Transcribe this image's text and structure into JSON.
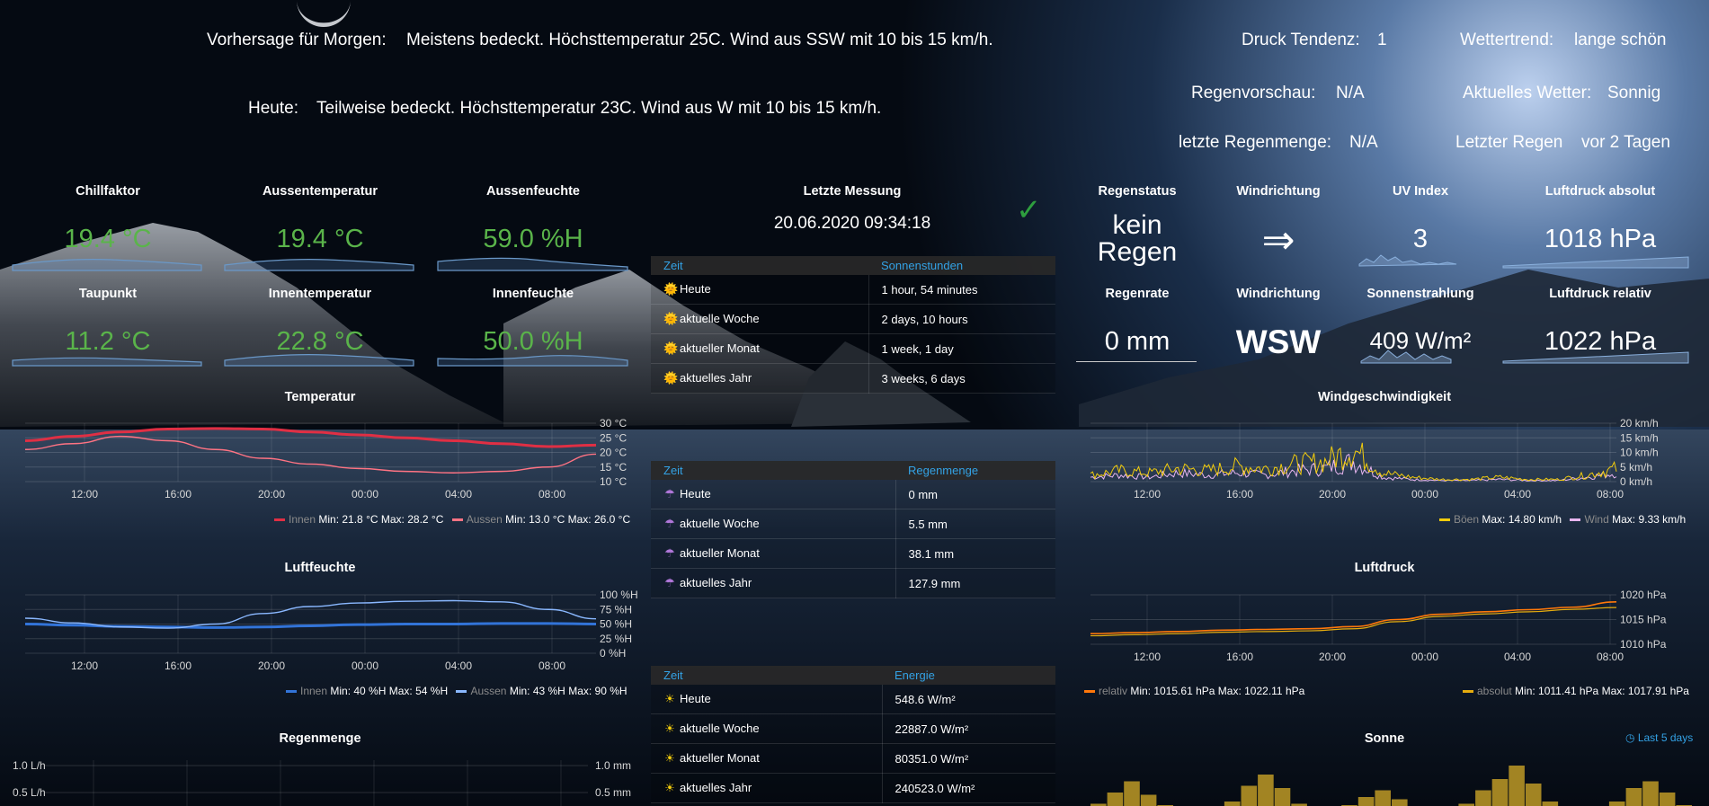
{
  "header": {
    "forecast_label": "Vorhersage für Morgen:",
    "forecast_text": "Meistens bedeckt. Höchsttemperatur 25C. Wind aus SSW mit 10 bis 15 km/h.",
    "today_label": "Heute:",
    "today_text": "Teilweise bedeckt. Höchsttemperatur 23C. Wind aus W mit 10 bis 15 km/h.",
    "pressure_trend_label": "Druck Tendenz:",
    "pressure_trend_value": "1",
    "weather_trend_label": "Wettertrend:",
    "weather_trend_value": "lange schön",
    "rain_forecast_label": "Regenvorschau:",
    "rain_forecast_value": "N/A",
    "current_weather_label": "Aktuelles Wetter:",
    "current_weather_value": "Sonnig",
    "last_rain_amount_label": "letzte Regenmenge:",
    "last_rain_amount_value": "N/A",
    "last_rain_label": "Letzter Regen",
    "last_rain_value": "vor 2 Tagen"
  },
  "stats": {
    "chill": {
      "title": "Chillfaktor",
      "value": "19.4 °C"
    },
    "outtemp": {
      "title": "Aussentemperatur",
      "value": "19.4 °C"
    },
    "outhum": {
      "title": "Aussenfeuchte",
      "value": "59.0 %H"
    },
    "dew": {
      "title": "Taupunkt",
      "value": "11.2 °C"
    },
    "intemp": {
      "title": "Innentemperatur",
      "value": "22.8 °C"
    },
    "inhum": {
      "title": "Innenfeuchte",
      "value": "50.0 %H"
    }
  },
  "last_measure": {
    "title": "Letzte Messung",
    "value": "20.06.2020 09:34:18",
    "status_icon": "check-icon",
    "status_color": "#2e9e3e"
  },
  "right_stats": {
    "rain_status": {
      "title": "Regenstatus",
      "line1": "kein",
      "line2": "Regen"
    },
    "wind_dir1": {
      "title": "Windrichtung",
      "value": "⇒"
    },
    "uv": {
      "title": "UV Index",
      "value": "3"
    },
    "abs_pressure": {
      "title": "Luftdruck absolut",
      "value": "1018 hPa"
    },
    "rain_rate": {
      "title": "Regenrate",
      "value": "0 mm"
    },
    "wind_dir2": {
      "title": "Windrichtung",
      "value": "WSW"
    },
    "solar": {
      "title": "Sonnenstrahlung",
      "value": "409 W/m²"
    },
    "rel_pressure": {
      "title": "Luftdruck relativ",
      "value": "1022 hPa"
    }
  },
  "sun_table": {
    "headers": [
      "Zeit",
      "Sonnenstunden"
    ],
    "icon": "sun-emoji-icon",
    "rows": [
      [
        "Heute",
        "1 hour, 54 minutes"
      ],
      [
        "aktuelle Woche",
        "2 days, 10 hours"
      ],
      [
        "aktueller Monat",
        "1 week, 1 day"
      ],
      [
        "aktuelles Jahr",
        "3 weeks, 6 days"
      ]
    ]
  },
  "rain_table": {
    "headers": [
      "Zeit",
      "Regenmenge"
    ],
    "icon": "umbrella-icon",
    "rows": [
      [
        "Heute",
        "0 mm"
      ],
      [
        "aktuelle Woche",
        "5.5 mm"
      ],
      [
        "aktueller Monat",
        "38.1 mm"
      ],
      [
        "aktuelles Jahr",
        "127.9 mm"
      ]
    ]
  },
  "energy_table": {
    "headers": [
      "Zeit",
      "Energie"
    ],
    "icon": "sun-icon",
    "rows": [
      [
        "Heute",
        "548.6 W/m²"
      ],
      [
        "aktuelle Woche",
        "22887.0 W/m²"
      ],
      [
        "aktueller Monat",
        "80351.0 W/m²"
      ],
      [
        "aktuelles Jahr",
        "240523.0 W/m²"
      ]
    ]
  },
  "chart_data": [
    {
      "type": "line",
      "title": "Temperatur",
      "x_ticks": [
        "12:00",
        "16:00",
        "20:00",
        "00:00",
        "04:00",
        "08:00"
      ],
      "y_ticks": [
        "30 °C",
        "25 °C",
        "20 °C",
        "15 °C",
        "10 °C"
      ],
      "ylim": [
        10,
        30
      ],
      "series": [
        {
          "name": "Innen",
          "color": "#e02f44",
          "min_label": "Min: 21.8 °C",
          "max_label": "Max: 28.2 °C",
          "values": [
            24.0,
            25.5,
            27.0,
            28.0,
            28.2,
            28.0,
            27.0,
            26.0,
            25.0,
            24.0,
            23.0,
            22.0,
            22.5
          ]
        },
        {
          "name": "Aussen",
          "color": "#ff7383",
          "min_label": "Min: 13.0 °C",
          "max_label": "Max: 26.0 °C",
          "values": [
            21.0,
            23.0,
            25.5,
            24.0,
            21.0,
            18.0,
            16.0,
            14.5,
            13.5,
            13.0,
            13.5,
            15.0,
            19.4
          ]
        }
      ]
    },
    {
      "type": "line",
      "title": "Luftfeuchte",
      "x_ticks": [
        "12:00",
        "16:00",
        "20:00",
        "00:00",
        "04:00",
        "08:00"
      ],
      "y_ticks": [
        "100 %H",
        "75 %H",
        "50 %H",
        "25 %H",
        "0 %H"
      ],
      "ylim": [
        0,
        100
      ],
      "series": [
        {
          "name": "Innen",
          "color": "#3274d9",
          "min_label": "Min: 40 %H",
          "max_label": "Max: 54 %H",
          "values": [
            50,
            48,
            46,
            45,
            44,
            45,
            47,
            49,
            50,
            50,
            51,
            51,
            50
          ]
        },
        {
          "name": "Aussen",
          "color": "#8ab8ff",
          "min_label": "Min: 43 %H",
          "max_label": "Max: 90 %H",
          "values": [
            60,
            52,
            45,
            43,
            50,
            68,
            80,
            86,
            89,
            90,
            88,
            75,
            59
          ]
        }
      ]
    },
    {
      "type": "line",
      "title": "Windgeschwindigkeit",
      "x_ticks": [
        "12:00",
        "16:00",
        "20:00",
        "00:00",
        "04:00",
        "08:00"
      ],
      "y_ticks": [
        "20 km/h",
        "15 km/h",
        "10 km/h",
        "5 km/h",
        "0 km/h"
      ],
      "ylim": [
        0,
        20
      ],
      "series": [
        {
          "name": "Böen",
          "color": "#f2cc0c",
          "min_label": "",
          "max_label": "Max: 14.80 km/h",
          "values": [
            3,
            5,
            4,
            6,
            5,
            7,
            6,
            8,
            9,
            14.8,
            4,
            2,
            1,
            1,
            2,
            1,
            1,
            3,
            6
          ]
        },
        {
          "name": "Wind",
          "color": "#e8b6f0",
          "min_label": "",
          "max_label": "Max: 9.33 km/h",
          "values": [
            2,
            3,
            2,
            4,
            3,
            4,
            3,
            5,
            6,
            9.33,
            2,
            1,
            0.5,
            0.5,
            1,
            0.5,
            0.5,
            2,
            4
          ]
        }
      ]
    },
    {
      "type": "line",
      "title": "Luftdruck",
      "x_ticks": [
        "12:00",
        "16:00",
        "20:00",
        "00:00",
        "04:00",
        "08:00"
      ],
      "y_ticks": [
        "1020 hPa",
        "1015 hPa",
        "1010 hPa"
      ],
      "ylim": [
        1008,
        1022
      ],
      "series": [
        {
          "name": "relativ",
          "color": "#ff780a",
          "min_label": "Min: 1015.61 hPa",
          "max_label": "Max: 1022.11 hPa",
          "values": [
            1011.0,
            1011.3,
            1011.6,
            1012.0,
            1012.2,
            1012.4,
            1013.0,
            1015.0,
            1016.5,
            1017.2,
            1017.8,
            1018.5,
            1020.0
          ]
        },
        {
          "name": "absolut",
          "color": "#e5ac0e",
          "min_label": "Min: 1011.41 hPa",
          "max_label": "Max: 1017.91 hPa",
          "values": [
            1010.4,
            1010.7,
            1011.0,
            1011.4,
            1011.6,
            1011.8,
            1012.4,
            1014.4,
            1015.9,
            1016.6,
            1017.2,
            1017.9,
            1018.4
          ]
        }
      ]
    },
    {
      "type": "bar",
      "title": "Regenmenge",
      "y_ticks_left": [
        "1.0 L/h",
        "0.5 L/h"
      ],
      "y_ticks_right": [
        "1.0 mm",
        "0.5 mm"
      ],
      "ylim": [
        0,
        1
      ],
      "values": []
    },
    {
      "type": "bar",
      "title": "Sonne",
      "time_range_label": "Last 5 days",
      "color": "#c9a227",
      "values": [
        0.05,
        0.3,
        0.55,
        0.25,
        0.02,
        0.0,
        0.0,
        0.0,
        0.1,
        0.45,
        0.7,
        0.4,
        0.05,
        0.0,
        0.0,
        0.02,
        0.2,
        0.35,
        0.15,
        0.0,
        0.0,
        0.0,
        0.05,
        0.35,
        0.6,
        0.9,
        0.5,
        0.1,
        0.0,
        0.0,
        0.0,
        0.1,
        0.4,
        0.55,
        0.3,
        0.02
      ]
    }
  ]
}
